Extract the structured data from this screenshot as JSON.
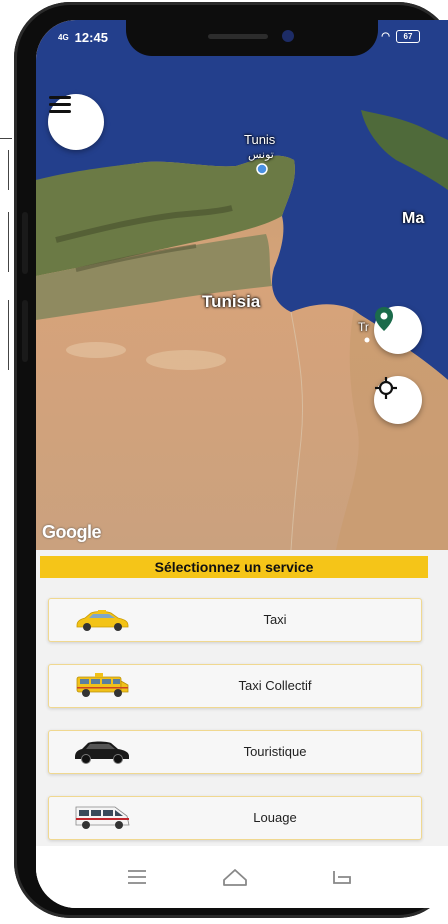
{
  "status_bar": {
    "network": "4G",
    "time": "12:45",
    "battery_level": "67"
  },
  "map": {
    "labels": {
      "tunis": "Tunis",
      "tunis_arabic": "تونس",
      "tunisia": "Tunisia",
      "malta_partial": "Ma",
      "tripoli_partial": "Tr"
    },
    "attribution": "Google"
  },
  "panel": {
    "title": "Sélectionnez un service",
    "services": [
      {
        "label": "Taxi",
        "icon": "yellow-taxi-icon"
      },
      {
        "label": "Taxi Collectif",
        "icon": "yellow-minivan-icon"
      },
      {
        "label": "Touristique",
        "icon": "black-suv-icon"
      },
      {
        "label": "Louage",
        "icon": "white-van-icon"
      }
    ]
  },
  "colors": {
    "accent": "#f5c518",
    "location_pin": "#1b6b4b",
    "sea": "#1f3f8a"
  },
  "icons": {
    "menu": "hamburger-menu-icon",
    "pin": "map-pin-icon",
    "locate": "my-location-icon",
    "nav_menu": "nav-menu-icon",
    "nav_home": "nav-home-icon",
    "nav_back": "nav-back-icon"
  }
}
